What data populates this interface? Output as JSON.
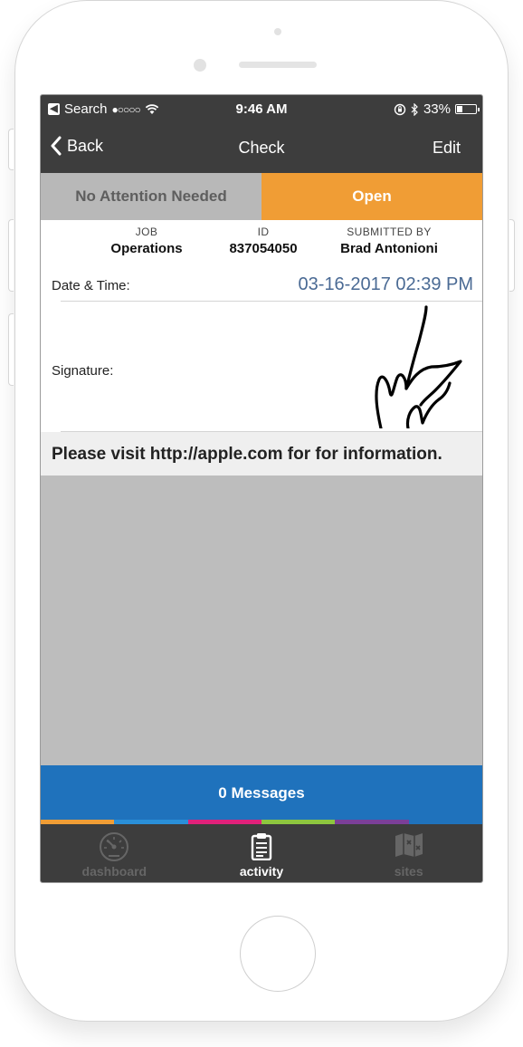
{
  "status_bar": {
    "carrier": "Search",
    "signal": "●○○○○",
    "time": "9:46 AM",
    "battery": "33%",
    "battery_level": 0.33
  },
  "nav": {
    "back_label": "Back",
    "title": "Check",
    "edit_label": "Edit"
  },
  "segments": {
    "left": "No Attention Needed",
    "right": "Open"
  },
  "meta": {
    "job_label": "JOB",
    "job_value": "Operations",
    "id_label": "ID",
    "id_value": "837054050",
    "submitted_label": "SUBMITTED BY",
    "submitted_value": "Brad Antonioni"
  },
  "detail": {
    "datetime_label": "Date & Time:",
    "datetime_value": "03-16-2017 02:39 PM",
    "signature_label": "Signature:"
  },
  "info_text": "Please visit http://apple.com for for information.",
  "messages_label": "0 Messages",
  "color_strip": [
    "#f09d35",
    "#2a8fd8",
    "#e0217a",
    "#8dc63f",
    "#7b3f98",
    "#1f72bc"
  ],
  "tabs": [
    {
      "label": "dashboard",
      "icon": "speedometer-icon"
    },
    {
      "label": "activity",
      "icon": "clipboard-icon"
    },
    {
      "label": "sites",
      "icon": "map-icon"
    }
  ],
  "colors": {
    "accent_orange": "#f09d35",
    "accent_blue": "#1f72bc",
    "bar_dark": "#3d3d3d",
    "datetime_blue": "#4a6a94"
  }
}
